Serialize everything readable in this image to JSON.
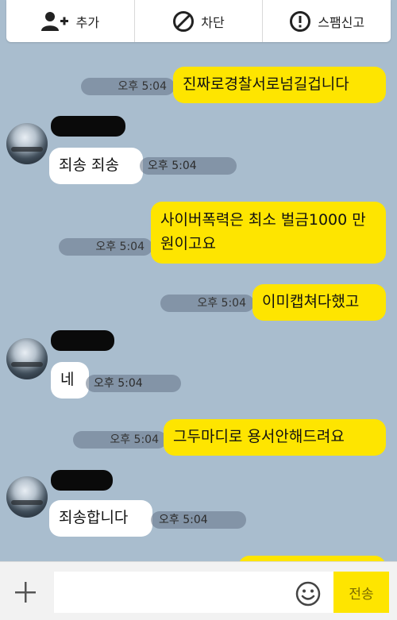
{
  "action_bar": {
    "add_label": "추가",
    "block_label": "차단",
    "report_label": "스팸신고"
  },
  "messages": [
    {
      "sender": "me",
      "text": "진짜로경찰서로넘길겁니다",
      "time": "오후 5:04"
    },
    {
      "sender": "other",
      "text": "죄송 죄송",
      "time": "오후 5:04"
    },
    {
      "sender": "me",
      "text": "사이버폭력은 최소 벌금1000 만원이고요",
      "time": "오후 5:04"
    },
    {
      "sender": "me",
      "text": "이미캡쳐다했고",
      "time": "오후 5:04"
    },
    {
      "sender": "other",
      "text": "네",
      "time": "오후 5:04"
    },
    {
      "sender": "me",
      "text": "그두마디로 용서안해드려요",
      "time": "오후 5:04"
    },
    {
      "sender": "other",
      "text": "죄송합니다",
      "time": "오후 5:04"
    }
  ],
  "input": {
    "placeholder": "",
    "send_label": "전송"
  },
  "colors": {
    "background": "#a9bdce",
    "my_bubble": "#fee500",
    "other_bubble": "#ffffff"
  }
}
